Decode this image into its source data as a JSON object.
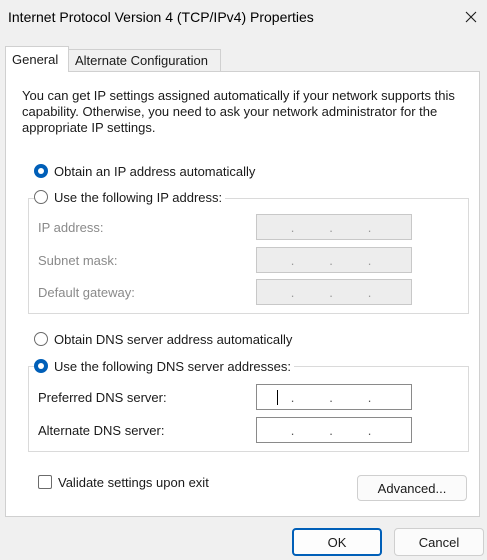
{
  "window": {
    "title": "Internet Protocol Version 4 (TCP/IPv4) Properties"
  },
  "tabs": [
    {
      "label": "General",
      "selected": true
    },
    {
      "label": "Alternate Configuration",
      "selected": false
    }
  ],
  "intro_text": "You can get IP settings assigned automatically if your network supports this capability. Otherwise, you need to ask your network administrator for the appropriate IP settings.",
  "ip_section": {
    "auto_label": "Obtain an IP address automatically",
    "auto_selected": true,
    "manual_label": "Use the following IP address:",
    "manual_selected": false,
    "fields": [
      {
        "label": "IP address:",
        "value": ". . ."
      },
      {
        "label": "Subnet mask:",
        "value": ". . ."
      },
      {
        "label": "Default gateway:",
        "value": ". . ."
      }
    ]
  },
  "dns_section": {
    "auto_label": "Obtain DNS server address automatically",
    "auto_selected": false,
    "manual_label": "Use the following DNS server addresses:",
    "manual_selected": true,
    "fields": [
      {
        "label": "Preferred DNS server:",
        "value": ". . ."
      },
      {
        "label": "Alternate DNS server:",
        "value": ". . ."
      }
    ]
  },
  "validate": {
    "label": "Validate settings upon exit",
    "checked": false
  },
  "buttons": {
    "advanced": "Advanced...",
    "ok": "OK",
    "cancel": "Cancel"
  },
  "colors": {
    "accent": "#005fb8",
    "dialog_bg": "#f0f0f0",
    "panel_bg": "#ffffff"
  },
  "icons": {
    "close": "close-icon"
  }
}
